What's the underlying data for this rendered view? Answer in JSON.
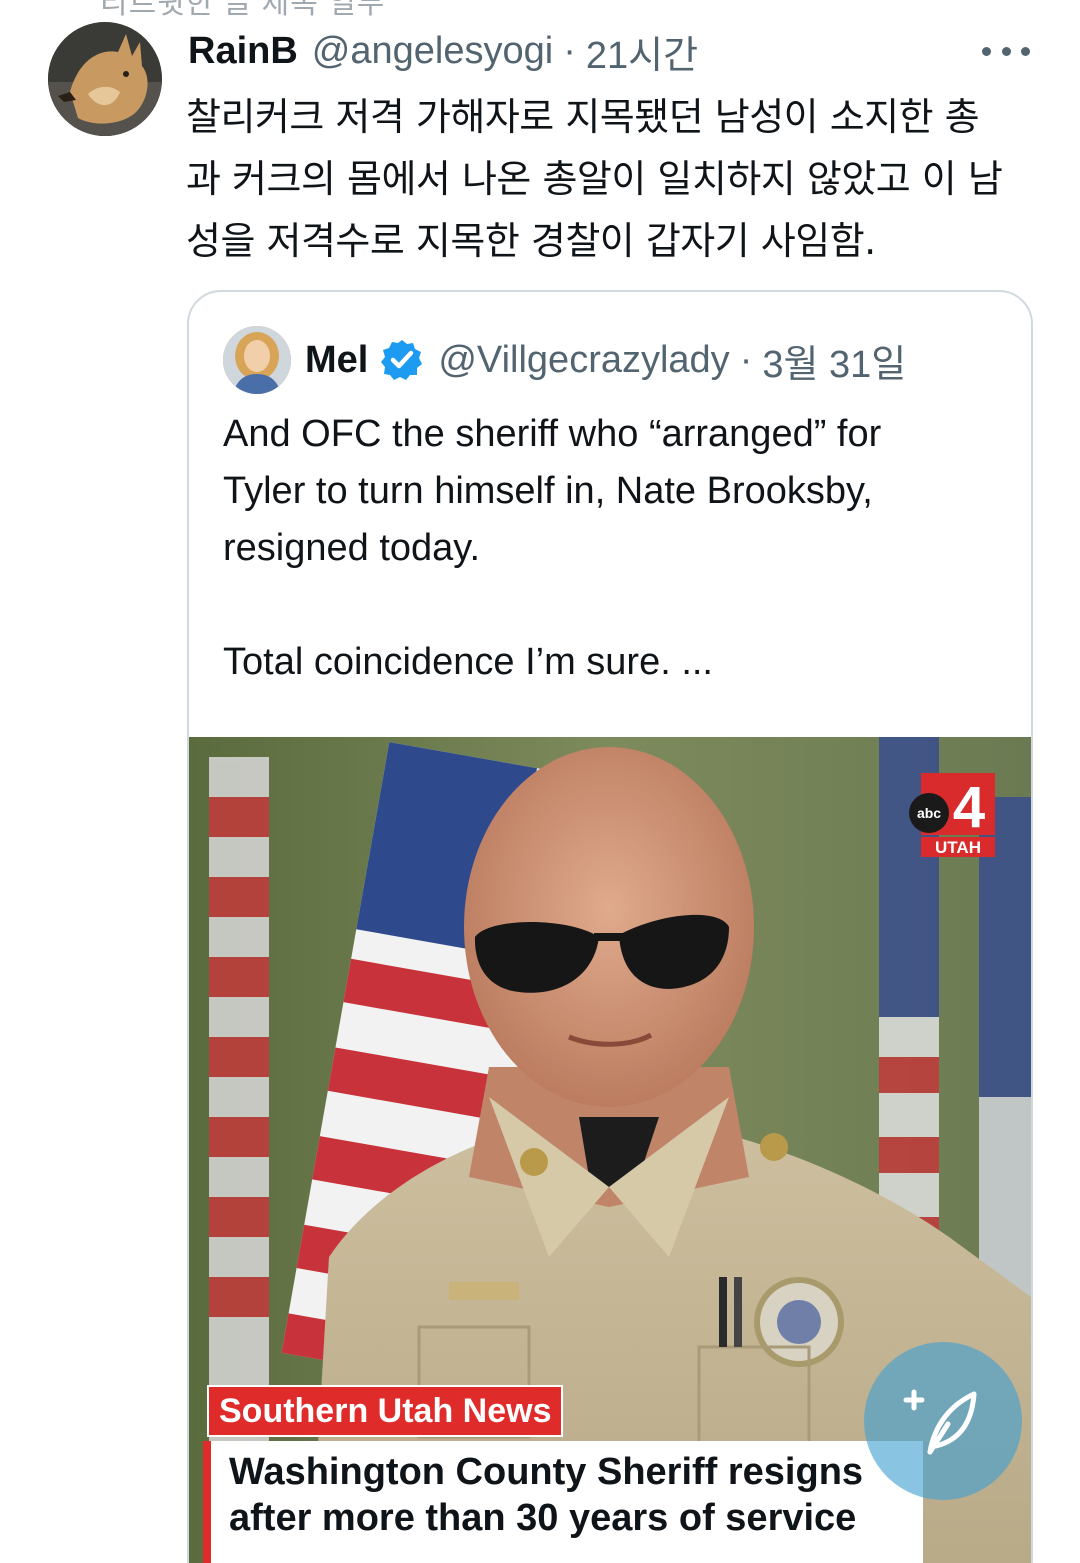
{
  "top_context": "리트윗한 글 제목 일부",
  "tweet": {
    "display_name": "RainB",
    "handle": "@angelesyogi",
    "separator": "·",
    "time": "21시간",
    "text_lines": [
      "찰리커크 저격 가해자로 지목됐던 남성이 소지한 총",
      "과 커크의 몸에서 나온 총알이 일치하지 않았고 이 남",
      "성을 저격수로 지목한 경찰이 갑자기 사임함."
    ],
    "avatar_icon": "dog-avatar-icon",
    "more_icon": "more-options-icon"
  },
  "quote": {
    "display_name": "Mel",
    "handle": "@Villgecrazylady",
    "separator": "·",
    "time": "3월 31일",
    "verified_icon": "verified-badge-icon",
    "paragraph_1": [
      "And OFC the sheriff who “arranged” for",
      "Tyler to turn himself in, Nate Brooksby,",
      "resigned today."
    ],
    "paragraph_2": "Total coincidence I’m sure.  ...",
    "media": {
      "station_logo_text": "abc",
      "station_number": "4",
      "station_region": "UTAH",
      "news_tag": "Southern Utah News",
      "headline_lines": [
        "Washington County Sheriff resigns",
        "after more than 30 years of service"
      ]
    }
  },
  "fab": {
    "icon": "compose-feather-icon"
  },
  "colors": {
    "text_primary": "#0f1419",
    "text_secondary": "#536471",
    "border": "#cfd9de",
    "verified_blue": "#1d9bf0",
    "news_red": "#e02b2b",
    "fab_blue": "#40a0d2"
  }
}
